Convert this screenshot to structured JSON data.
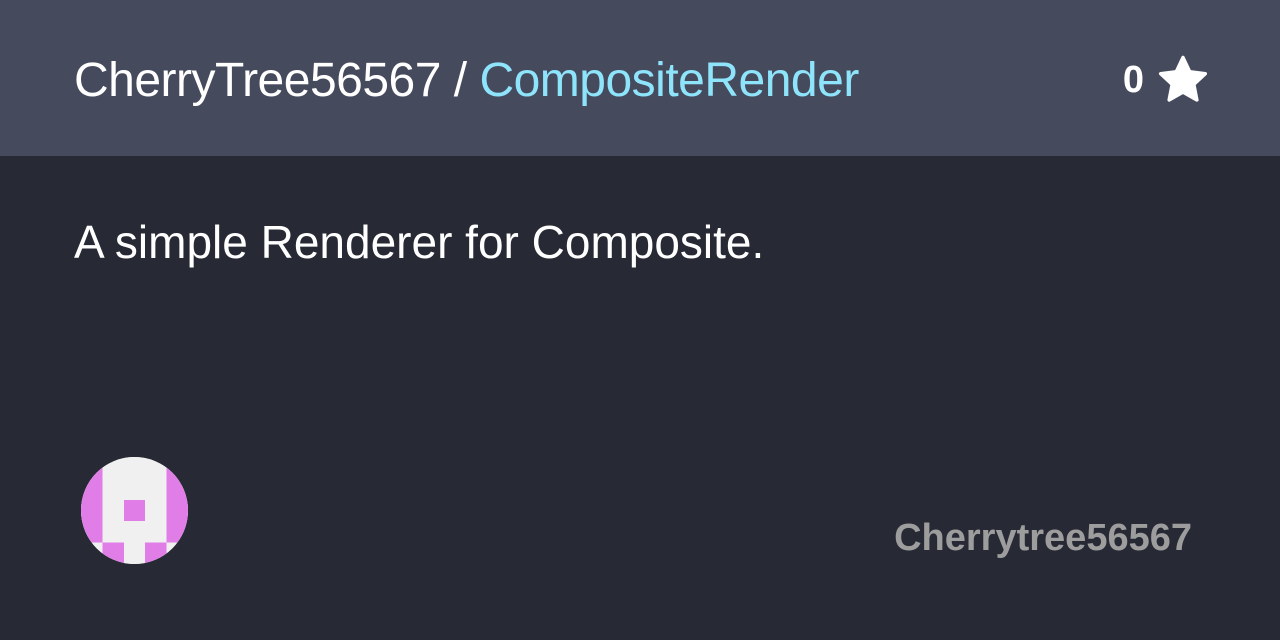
{
  "header": {
    "owner": "CherryTree56567",
    "separator": " / ",
    "repo": "CompositeRender",
    "star_count": "0"
  },
  "description": "A simple Renderer for Composite.",
  "footer": {
    "username": "Cherrytree56567"
  },
  "colors": {
    "header_bg": "#464a5d",
    "body_bg": "#272935",
    "repo_name": "#8ee4fb",
    "avatar_fill": "#e07de7",
    "username": "#9d9d9d"
  },
  "icons": {
    "star": "star-icon",
    "avatar": "identicon-avatar"
  }
}
